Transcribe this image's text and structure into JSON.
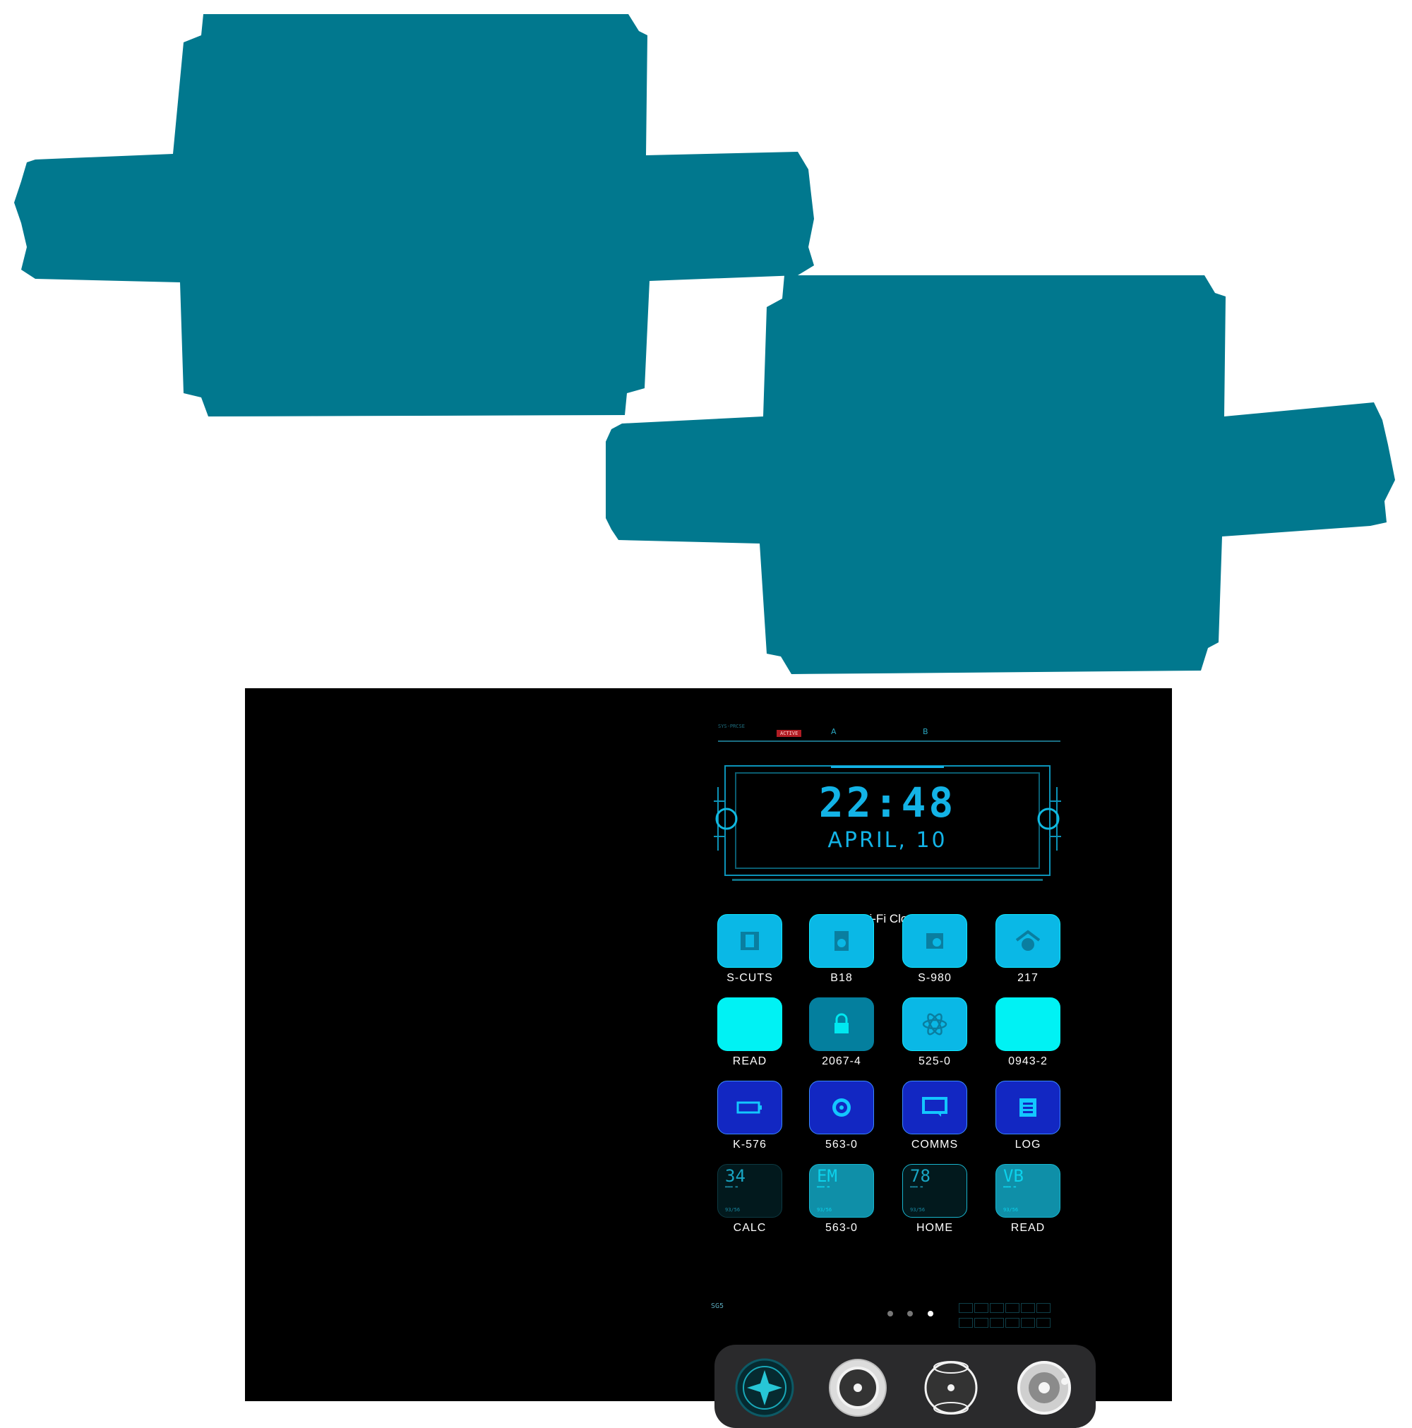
{
  "colors": {
    "hero": "#01788e",
    "screen": "#000000",
    "accent": "#13b3e6"
  },
  "status_bar": {
    "tag": "SYS-PRCSE",
    "active_badge": "ACTIVE",
    "marker_a": "A",
    "marker_b": "B"
  },
  "clock_widget": {
    "time": "22:48",
    "date": "APRIL, 10",
    "label": "Sci-Fi Clock"
  },
  "apps": [
    {
      "label": "S-CUTS",
      "icon": "film-icon"
    },
    {
      "label": "B18",
      "icon": "speaker-icon"
    },
    {
      "label": "S-980",
      "icon": "camera-icon"
    },
    {
      "label": "217",
      "icon": "home-icon"
    },
    {
      "label": "READ",
      "icon": "blank-icon"
    },
    {
      "label": "2067-4",
      "icon": "lock-icon"
    },
    {
      "label": "525-0",
      "icon": "atom-icon"
    },
    {
      "label": "0943-2",
      "icon": "blank-icon"
    },
    {
      "label": "K-576",
      "icon": "battery-icon"
    },
    {
      "label": "563-0",
      "icon": "disc-icon"
    },
    {
      "label": "COMMS",
      "icon": "chat-icon"
    },
    {
      "label": "LOG",
      "icon": "list-icon"
    },
    {
      "label": "CALC",
      "icon": "counter-34-icon",
      "big": "34",
      "foot": "93/56"
    },
    {
      "label": "563-0",
      "icon": "counter-em-icon",
      "big": "EM",
      "foot": "93/56"
    },
    {
      "label": "HOME",
      "icon": "counter-78-icon",
      "big": "78",
      "foot": "93/56"
    },
    {
      "label": "READ",
      "icon": "counter-vb-icon",
      "big": "VB",
      "foot": "93/56"
    }
  ],
  "info_row": {
    "tag": "SG5"
  },
  "page_indicator": {
    "pages": 3,
    "current": 3
  },
  "dock": [
    {
      "icon": "compass-icon"
    },
    {
      "icon": "radar-icon"
    },
    {
      "icon": "gyro-icon"
    },
    {
      "icon": "orbit-icon"
    }
  ]
}
